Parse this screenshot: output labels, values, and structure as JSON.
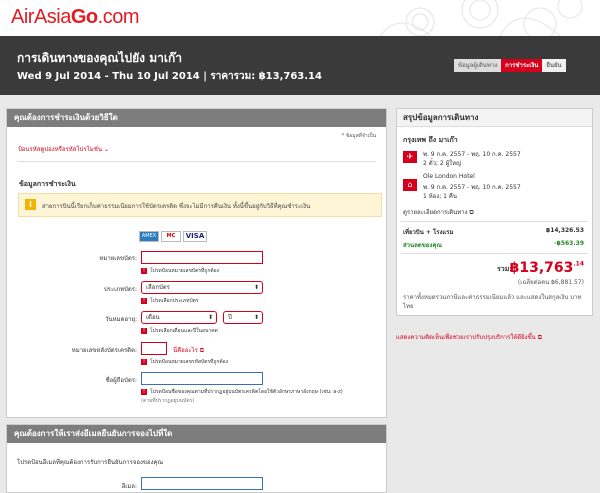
{
  "brand": {
    "part1": "AirAsia",
    "part2": "Go",
    "part3": ".com"
  },
  "hero": {
    "title": "การเดินทางของคุณไปยัง มาเก๊า",
    "subtitle": "Wed 9 Jul 2014 - Thu 10 Jul 2014 | ราคารวม: ฿13,763.14"
  },
  "steps": [
    "ข้อมูลผู้เดินทาง",
    "การชำระเงิน",
    "ยืนยัน"
  ],
  "payment": {
    "heading": "คุณต้องการชำระเงินด้วยวิธีใด",
    "required_note": "* ข้อมูลที่จำเป็น",
    "promo_link": "ป้อนรหัสคูปองหรือรหัสโปรโมชั่น",
    "section_title": "ข้อมูลการชำระเงิน",
    "notice": "สายการบินนี้เรียกเก็บค่าธรรมเนียมการใช้บัตรเครดิต ซึ่งจะไม่มีการคืนเงิน ทั้งนี้ขึ้นอยู่กับวิธีที่คุณชำระเงิน",
    "cards": [
      "AMEX",
      "MC",
      "VISA"
    ],
    "card_number_label": "หมายเลขบัตร:",
    "card_number_err": "โปรดป้อนหมายเลขบัตรที่ถูกต้อง",
    "card_type_label": "ประเภทบัตร:",
    "card_type_value": "เลือกบัตร",
    "card_type_err": "โปรดเลือกประเภทบัตร",
    "expiry_label": "วันหมดอายุ:",
    "expiry_month": "เดือน",
    "expiry_year": "ปี",
    "expiry_err": "โปรดเลือกเดือนและปีในอนาคต",
    "cvv_label": "หมายเลขหลังบัตรเครดิต:",
    "cvv_link": "นี่คืออะไร",
    "cvv_err": "โปรดป้อนหมายเลขรหัสบัตรที่ถูกต้อง",
    "name_label": "ชื่อผู้ถือบัตร:",
    "name_err": "โปรดป้อนชื่อของคุณตามที่ปรากฏอยู่บนบัตรเครดิตโดยใช้ตัวอักษรภาษาอังกฤษ (เช่น: a-z)",
    "name_hint": "(ตามที่ปรากฏอยู่บนบัตร)"
  },
  "email": {
    "heading": "คุณต้องการให้เราส่งอีเมลยืนยันการจองไปที่ใด",
    "intro": "โปรดป้อนอีเมลที่คุณต้องการรับการยืนยันการจองของคุณ",
    "label": "อีเมล:"
  },
  "summary": {
    "heading": "สรุปข้อมูลการเดินทาง",
    "route": "กรุงเทพ ถึง มาเก๊า",
    "flight_dates": "พ. 9 ก.ค. 2557 - พฤ. 10 ก.ค. 2557",
    "flight_pax": "2 ตั๋ว; 2 ผู้ใหญ่",
    "hotel_name": "Ole London Hotel",
    "hotel_dates": "พ. 9 ก.ค. 2557 - พฤ. 10 ก.ค. 2557",
    "hotel_rooms": "1 ห้อง; 1 คืน",
    "details_link": "ดูรายละเอียดการเดินทาง",
    "flight_hotel_label": "เที่ยวบิน + โรงแรม",
    "flight_hotel_value": "฿14,326.53",
    "discount_label": "ส่วนลดของคุณ",
    "discount_value": "-฿563.39",
    "total_label": "รวม:",
    "total_main": "฿13,763",
    "total_dec": ".14",
    "per_person": "(เฉลี่ยต่อคน ฿6,881.57)",
    "note": "ราคาทั้งหมดรวมภาษีและค่าธรรมเนียมแล้ว และแสดงในสกุลเงิน บาทไทย"
  },
  "feedback_link": "แสดงความคิดเห็นเพื่อช่วยเราปรับปรุงบริการให้ดียิ่งขึ้น",
  "colors": {
    "brand_red": "#e31b23",
    "hero_bg": "#3a3a3a",
    "discount_green": "#2a8a2a"
  }
}
